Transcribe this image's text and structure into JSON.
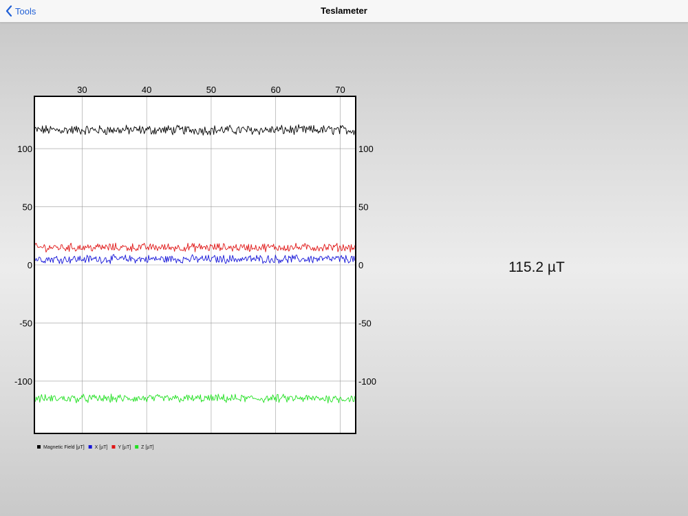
{
  "navbar": {
    "back_label": "Tools",
    "title": "Teslameter"
  },
  "readout": {
    "value": "115.2 µT"
  },
  "chart_data": {
    "type": "line",
    "title": "",
    "xlabel": "",
    "ylabel": "",
    "xlim": [
      22.6,
      72.4
    ],
    "ylim": [
      -145,
      145
    ],
    "x_ticks": [
      30,
      40,
      50,
      60,
      70
    ],
    "y_ticks": [
      100,
      50,
      0,
      -50,
      -100
    ],
    "grid": true,
    "legend_position": "bottom-left",
    "series": [
      {
        "name": "Magnetic Field [µT]",
        "color": "#000000",
        "mean": 116,
        "noise": 3.5
      },
      {
        "name": "X [µT]",
        "color": "#1515d8",
        "mean": 5,
        "noise": 3
      },
      {
        "name": "Y [µT]",
        "color": "#e01515",
        "mean": 15,
        "noise": 3
      },
      {
        "name": "Z [µT]",
        "color": "#22e022",
        "mean": -115,
        "noise": 3
      }
    ]
  }
}
